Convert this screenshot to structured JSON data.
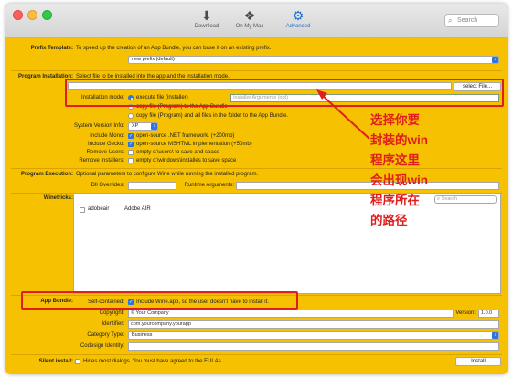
{
  "toolbar": {
    "items": [
      {
        "label": "Download",
        "icon": "download-icon",
        "active": false
      },
      {
        "label": "On My Mac",
        "icon": "wine-icon",
        "active": false
      },
      {
        "label": "Advanced",
        "icon": "advanced-icon",
        "active": true
      }
    ],
    "search_placeholder": "Search"
  },
  "prefix": {
    "label": "Prefix Template:",
    "description": "To speed up the creation of an App Bundle, you can base it on an existing prefix.",
    "selected": "new prefix (default)"
  },
  "program_installation": {
    "label": "Program Installation:",
    "description": "Select file to be installed into the app and the installation mode.",
    "file_value": "",
    "select_button": "select File...",
    "mode_label": "Installation mode:",
    "modes": [
      {
        "label": "execute file (installer)",
        "selected": true
      },
      {
        "label": "copy file (Program) to the App Bundle",
        "selected": false
      },
      {
        "label": "copy file (Program) and all files in the folder to the App Bundle.",
        "selected": false
      }
    ],
    "args_placeholder": "Installer Arguments (opt)"
  },
  "system_version": {
    "label": "System Version Info:",
    "value": "XP"
  },
  "options": [
    {
      "label": "Include Mono:",
      "text": "open-source .NET framework. (+200mb)",
      "checked": true
    },
    {
      "label": "Include Gecko:",
      "text": "open-source MSHTML implementation (+50mb)",
      "checked": true
    },
    {
      "label": "Remove Users:",
      "text": "empty c:\\users\\ to save and space",
      "checked": false
    },
    {
      "label": "Remove Installers:",
      "text": "empty c:\\windows\\installes to save space",
      "checked": false
    }
  ],
  "program_execution": {
    "label": "Program Execution:",
    "description": "Optional parameters to configure Wine while running the installed program.",
    "dll_label": "Dll Overrides:",
    "runtime_label": "Runtime Arguments:"
  },
  "winetricks": {
    "label": "Winetricks:",
    "search_placeholder": "Search",
    "rows": [
      {
        "name": "adobeair",
        "description": "Adobe AIR",
        "checked": false
      }
    ]
  },
  "app_bundle": {
    "label": "App Bundle:",
    "self_contained_label": "Self-contained:",
    "self_contained_text": "Include Wine.app, so the user doesn't have to install it.",
    "self_contained_checked": true,
    "copyright_label": "Copyright:",
    "copyright_value": "© Your Company",
    "version_label": "Version:",
    "version_value": "1.0.0",
    "identifier_label": "Identifier:",
    "identifier_value": "com.yourcompany.yourapp",
    "category_label": "Category Type:",
    "category_value": "Business",
    "codesign_label": "Codesign Identity:",
    "codesign_value": ""
  },
  "silent_install": {
    "label": "Silent install:",
    "text": "Hides most dialogs. You must have agreed to the EULAs.",
    "checked": false
  },
  "install_button": "Install",
  "annotation_lines": [
    "选择你要",
    "封装的win",
    "程序这里",
    "会出现win",
    "程序所在",
    "的路径"
  ],
  "colors": {
    "background": "#f6c100",
    "accent": "#2b74e2",
    "annotation": "#e01e1e"
  }
}
